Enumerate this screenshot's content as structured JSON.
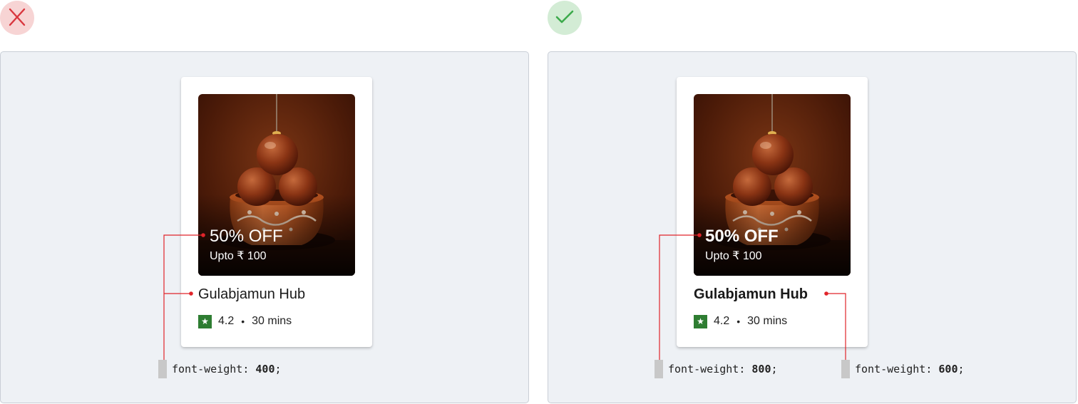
{
  "verdicts": {
    "incorrect": "cross-icon",
    "correct": "check-icon"
  },
  "colors": {
    "incorrect_badge": "#f7d4d4",
    "incorrect_mark": "#d9363e",
    "correct_badge": "#d3ecd5",
    "correct_mark": "#3daa4c",
    "panel_bg": "#eef1f5",
    "rating_badge": "#2e7d32",
    "annotation_line": "#e0242a"
  },
  "examples": {
    "incorrect": {
      "offer": "50% OFF",
      "offer_sub": "Upto ₹ 100",
      "restaurant": "Gulabjamun Hub",
      "star_icon": "★",
      "rating": "4.2",
      "separator": "•",
      "time": "30 mins",
      "annotation": {
        "prop": "font-weight:",
        "value": "400",
        "end": ";"
      }
    },
    "correct": {
      "offer": "50% OFF",
      "offer_sub": "Upto ₹ 100",
      "restaurant": "Gulabjamun Hub",
      "star_icon": "★",
      "rating": "4.2",
      "separator": "•",
      "time": "30 mins",
      "annotation_offer": {
        "prop": "font-weight:",
        "value": "800",
        "end": ";"
      },
      "annotation_title": {
        "prop": "font-weight:",
        "value": "600",
        "end": ";"
      }
    }
  }
}
